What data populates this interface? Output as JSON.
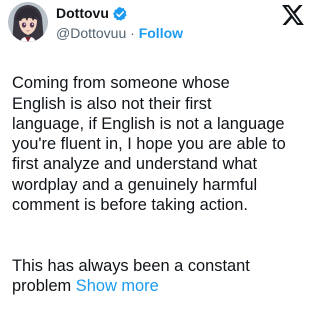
{
  "author": {
    "display_name": "Dottovu",
    "handle": "@Dottovuu",
    "separator": " · ",
    "follow_label": "Follow",
    "avatar_icon": "anime-character-avatar",
    "verified_icon": "verified-badge-icon"
  },
  "platform": {
    "logo_icon": "x-logo-icon"
  },
  "tweet": {
    "paragraph_1": "Coming from someone whose\nEnglish is also not their first\nlanguage, if English is not a language\nyou're fluent in, I hope you are able to\nfirst analyze and understand what\nwordplay and a genuinely harmful\ncomment is before taking action.",
    "paragraph_2": "This has always been a constant\nproblem ",
    "show_more_label": "Show more"
  },
  "colors": {
    "link_blue": "#1d9bf0",
    "secondary_text": "#536471",
    "primary_text": "#0f1419"
  }
}
